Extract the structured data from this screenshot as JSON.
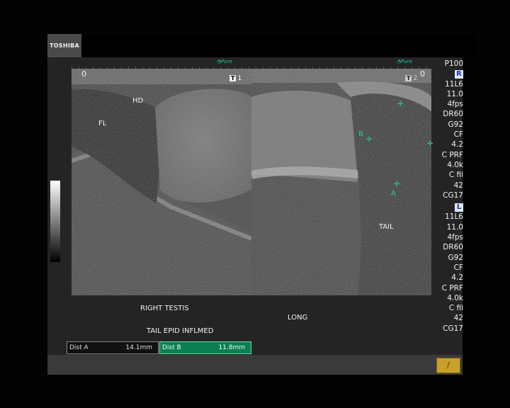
{
  "header": {
    "brand": "TOSHIBA"
  },
  "image": {
    "pure_left": "Pure",
    "pure_right": "Pure",
    "depth_zero_left": "0",
    "depth_zero_right": "0",
    "pane1_badge": "1",
    "pane2_badge": "2",
    "labels": {
      "hd": "HD",
      "fl": "FL",
      "tail": "TAIL"
    },
    "markers": {
      "a": "A",
      "b": "B"
    }
  },
  "params": {
    "top": "P100",
    "probe_r": "R",
    "probe_l": "L",
    "right_set": [
      "11L6",
      "11.0",
      "4fps",
      "DR60",
      "G92",
      "CF",
      "4.2",
      "C PRF",
      "4.0k",
      "C fil",
      "42",
      "CG17"
    ],
    "left_set": [
      "11L6",
      "11.0",
      "4fps",
      "DR60",
      "G92",
      "CF",
      "4.2",
      "C PRF",
      "4.0k",
      "C fil",
      "42",
      "CG17"
    ]
  },
  "annotations": {
    "right_testis": "RIGHT TESTIS",
    "long": "LONG",
    "tail_epid": "TAIL EPID INFLMED"
  },
  "measurements": {
    "dist_a_label": "Dist A",
    "dist_a_value": "14.1mm",
    "dist_b_label": "Dist B",
    "dist_b_value": "11.8mm"
  },
  "colors": {
    "measure_accent": "#19d3a9",
    "dist_b_bg": "#0b7f52"
  }
}
